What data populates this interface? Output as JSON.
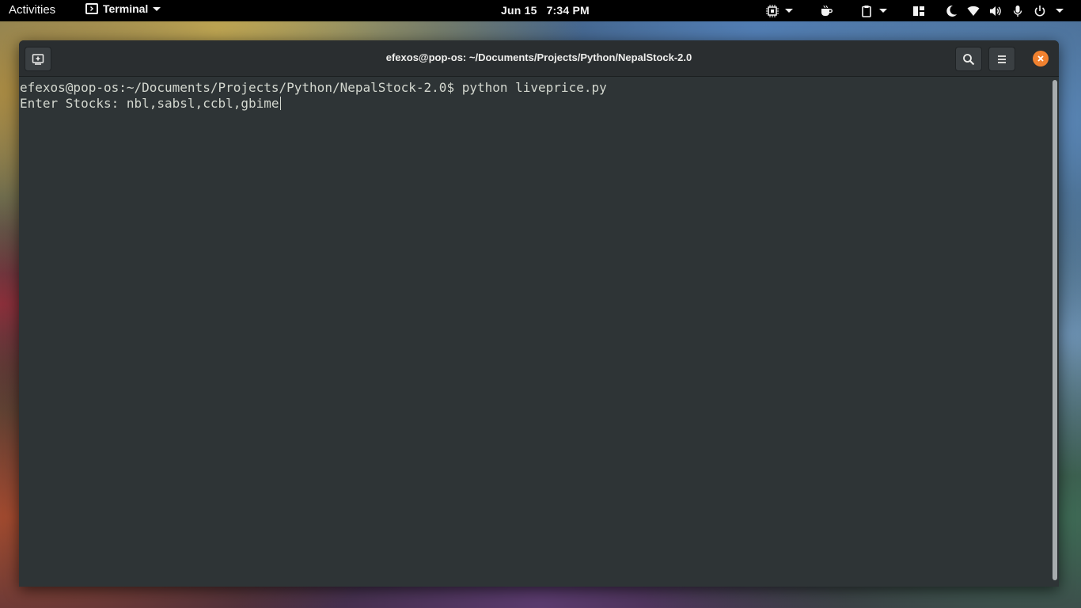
{
  "topbar": {
    "activities": "Activities",
    "app_name": "Terminal",
    "date": "Jun 15",
    "time": "7:34 PM"
  },
  "window": {
    "title": "efexos@pop-os: ~/Documents/Projects/Python/NepalStock-2.0"
  },
  "terminal": {
    "prompt": "efexos@pop-os:~/Documents/Projects/Python/NepalStock-2.0$ ",
    "command": "python liveprice.py",
    "input_prompt": "Enter Stocks: ",
    "input_value": "nbl,sabsl,ccbl,gbime"
  },
  "colors": {
    "topbar_bg": "#000000",
    "terminal_bg": "#2e3436",
    "terminal_fg": "#d3d7cf",
    "close_button": "#f0812f"
  },
  "icons": [
    "terminal-app-icon",
    "cpu-icon",
    "coffee-icon",
    "clipboard-icon",
    "tiling-icon",
    "moon-icon",
    "wifi-icon",
    "volume-icon",
    "microphone-icon",
    "power-icon",
    "new-tab-icon",
    "search-icon",
    "hamburger-menu-icon",
    "close-icon"
  ]
}
